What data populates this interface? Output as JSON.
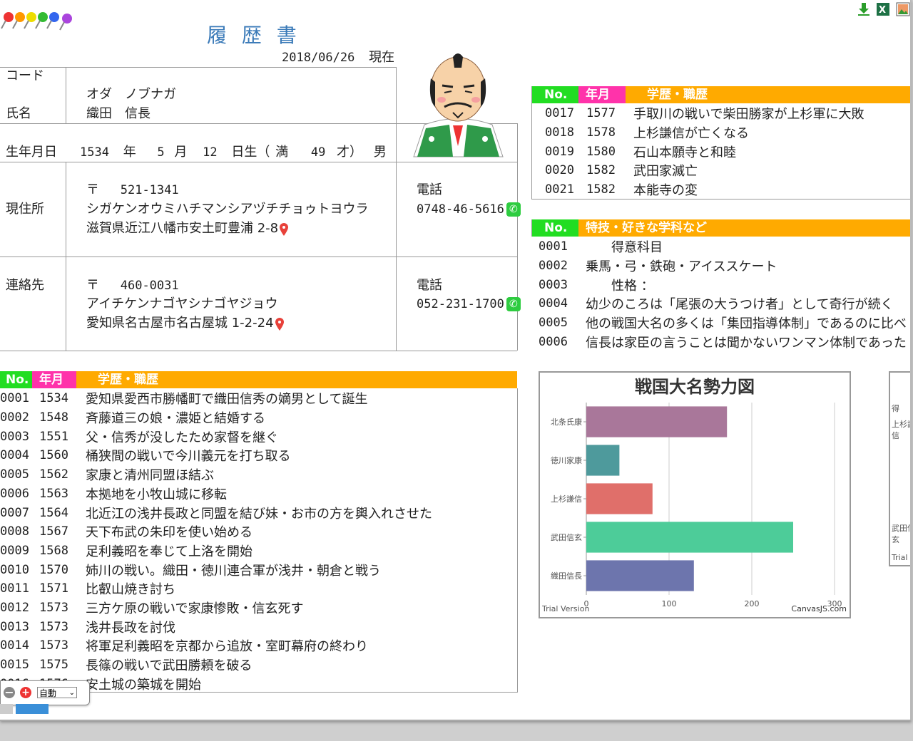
{
  "title": "履 歴 書",
  "date": "2018/06/26",
  "date_suffix": "現在",
  "labels": {
    "code": "コード",
    "name": "氏名",
    "birth": "生年月日",
    "address": "現住所",
    "contact": "連絡先",
    "phone": "電話",
    "postal_mark": "〒"
  },
  "person": {
    "kana": "オダ　ノブナガ",
    "name": "織田　信長",
    "birth_year": "1534",
    "birth_year_unit": "年",
    "birth_month": "5",
    "birth_month_unit": "月",
    "birth_day": "12",
    "birth_day_unit": "日生（",
    "age_prefix": "満",
    "age": "49",
    "age_suffix": "才）",
    "sex": "男"
  },
  "address": {
    "postal": "521-1341",
    "kana": "シガケンオウミハチマンシアヅチチョゥトヨウラ",
    "text": "滋賀県近江八幡市安土町豊浦 2-8",
    "phone": "0748-46-5616"
  },
  "contact": {
    "postal": "460-0031",
    "kana": "アイチケンナゴヤシナゴヤジョウ",
    "text": "愛知県名古屋市名古屋城 1-2-24",
    "phone": "052-231-1700"
  },
  "history_header": {
    "no": "No.",
    "ym": "年月",
    "title": "学歴・職歴"
  },
  "history": [
    {
      "no": "0001",
      "year": "1534",
      "text": "愛知県愛西市勝幡町で織田信秀の嫡男として誕生"
    },
    {
      "no": "0002",
      "year": "1548",
      "text": "斉藤道三の娘・濃姫と結婚する"
    },
    {
      "no": "0003",
      "year": "1551",
      "text": "父・信秀が没したため家督を継ぐ"
    },
    {
      "no": "0004",
      "year": "1560",
      "text": "桶狭間の戦いで今川義元を打ち取る"
    },
    {
      "no": "0005",
      "year": "1562",
      "text": "家康と清州同盟ほ結ぶ"
    },
    {
      "no": "0006",
      "year": "1563",
      "text": "本拠地を小牧山城に移転"
    },
    {
      "no": "0007",
      "year": "1564",
      "text": "北近江の浅井長政と同盟を結び妹・お市の方を輿入れさせた"
    },
    {
      "no": "0008",
      "year": "1567",
      "text": "天下布武の朱印を使い始める"
    },
    {
      "no": "0009",
      "year": "1568",
      "text": "足利義昭を奉じて上洛を開始"
    },
    {
      "no": "0010",
      "year": "1570",
      "text": "姉川の戦い。織田・徳川連合軍が浅井・朝倉と戦う"
    },
    {
      "no": "0011",
      "year": "1571",
      "text": "比叡山焼き討ち"
    },
    {
      "no": "0012",
      "year": "1573",
      "text": "三方ケ原の戦いで家康惨敗・信玄死す"
    },
    {
      "no": "0013",
      "year": "1573",
      "text": "浅井長政を討伐"
    },
    {
      "no": "0014",
      "year": "1573",
      "text": "将軍足利義昭を京都から追放・室町幕府の終わり"
    },
    {
      "no": "0015",
      "year": "1575",
      "text": "長篠の戦いで武田勝頼を破る"
    },
    {
      "no": "0016",
      "year": "1576",
      "text": "安土城の築城を開始"
    }
  ],
  "history2_header": {
    "no": "No.",
    "ym": "年月",
    "title": "学歴・職歴"
  },
  "history2": [
    {
      "no": "0017",
      "year": "1577",
      "text": "手取川の戦いで柴田勝家が上杉軍に大敗"
    },
    {
      "no": "0018",
      "year": "1578",
      "text": "上杉謙信が亡くなる"
    },
    {
      "no": "0019",
      "year": "1580",
      "text": "石山本願寺と和睦"
    },
    {
      "no": "0020",
      "year": "1582",
      "text": "武田家滅亡"
    },
    {
      "no": "0021",
      "year": "1582",
      "text": "本能寺の変"
    }
  ],
  "skills_header": {
    "no": "No.",
    "title": "特技・好きな学科など"
  },
  "skills": [
    {
      "no": "0001",
      "text": "　　得意科目"
    },
    {
      "no": "0002",
      "text": "乗馬・弓・鉄砲・アイススケート"
    },
    {
      "no": "0003",
      "text": "　　性格 ："
    },
    {
      "no": "0004",
      "text": "幼少のころは「尾張の大うつけ者」として奇行が続く"
    },
    {
      "no": "0005",
      "text": "他の戦国大名の多くは「集団指導体制」であるのに比べ"
    },
    {
      "no": "0006",
      "text": "信長は家臣の言うことは聞かないワンマン体制であった"
    }
  ],
  "chart_data": {
    "type": "bar",
    "orientation": "horizontal",
    "title": "戦国大名勢力図",
    "categories": [
      "北条氏康",
      "徳川家康",
      "上杉謙信",
      "武田信玄",
      "織田信長"
    ],
    "values": [
      170,
      40,
      80,
      250,
      130
    ],
    "colors": [
      "#a9779a",
      "#4e9a9c",
      "#e06f6a",
      "#4dcc99",
      "#6d75ad"
    ],
    "xlim": [
      0,
      300
    ],
    "xticks": [
      0,
      100,
      200,
      300
    ],
    "footer_left": "Trial Version",
    "footer_right": "CanvasJS.com",
    "grid": true
  },
  "chart2_fragment": {
    "labels": [
      "得",
      "上杉謙",
      "信",
      "武田信",
      "玄",
      "Trial V"
    ]
  },
  "zoom": {
    "value": "自動"
  },
  "colors": {
    "no_bg": "#22dd22",
    "ym_bg": "#ff33aa",
    "title_bg": "#ffaa00",
    "heading": "#3a7ab8"
  }
}
